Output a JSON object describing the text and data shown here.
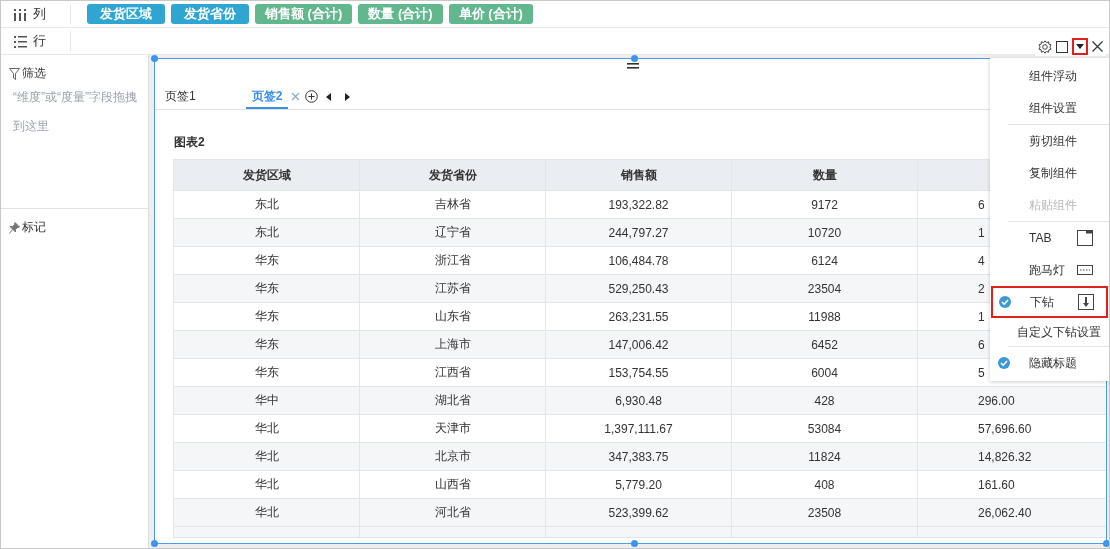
{
  "shelves": [
    {
      "label": "列",
      "kind": "columns",
      "fields": [
        {
          "label": "发货区域",
          "kind": "dimension"
        },
        {
          "label": "发货省份",
          "kind": "dimension"
        },
        {
          "label": "销售额 (合计)",
          "kind": "measure"
        },
        {
          "label": "数量 (合计)",
          "kind": "measure"
        },
        {
          "label": "单价 (合计)",
          "kind": "measure"
        }
      ]
    },
    {
      "label": "行",
      "kind": "rows"
    }
  ],
  "sidebar": {
    "filter": {
      "title": "筛选",
      "hint": "“维度”或“度量”字段拖拽到这里"
    },
    "marks": {
      "title": "标记"
    }
  },
  "tabs": [
    {
      "label": "页签1",
      "selected": false
    },
    {
      "label": "页签2",
      "selected": true
    }
  ],
  "component": {
    "title": "图表2",
    "table": {
      "columns": [
        "发货区域",
        "发货省份",
        "销售额",
        "数量"
      ],
      "rows": [
        [
          "东北",
          "吉林省",
          "193,322.82",
          "9172",
          "6"
        ],
        [
          "东北",
          "辽宁省",
          "244,797.27",
          "10720",
          "1"
        ],
        [
          "华东",
          "浙江省",
          "106,484.78",
          "6124",
          "4"
        ],
        [
          "华东",
          "江苏省",
          "529,250.43",
          "23504",
          "2"
        ],
        [
          "华东",
          "山东省",
          "263,231.55",
          "11988",
          "1"
        ],
        [
          "华东",
          "上海市",
          "147,006.42",
          "6452",
          "6"
        ],
        [
          "华东",
          "江西省",
          "153,754.55",
          "6004",
          "5"
        ],
        [
          "华中",
          "湖北省",
          "6,930.48",
          "428",
          "296.00"
        ],
        [
          "华北",
          "天津市",
          "1,397,111.67",
          "53084",
          "57,696.60"
        ],
        [
          "华北",
          "北京市",
          "347,383.75",
          "11824",
          "14,826.32"
        ],
        [
          "华北",
          "山西省",
          "5,779.20",
          "408",
          "161.60"
        ],
        [
          "华北",
          "河北省",
          "523,399.62",
          "23508",
          "26,062.40"
        ]
      ]
    }
  },
  "toolbar": {
    "dropdown_highlighted": true
  },
  "menu": [
    {
      "kind": "item",
      "label": "组件浮动",
      "checked": false,
      "disabled": false,
      "highlighted": false
    },
    {
      "kind": "item",
      "label": "组件设置",
      "checked": false,
      "disabled": false,
      "highlighted": false
    },
    {
      "kind": "divider"
    },
    {
      "kind": "item",
      "label": "剪切组件",
      "checked": false,
      "disabled": false,
      "highlighted": false
    },
    {
      "kind": "item",
      "label": "复制组件",
      "checked": false,
      "disabled": false,
      "highlighted": false
    },
    {
      "kind": "item",
      "label": "粘贴组件",
      "checked": false,
      "disabled": true,
      "highlighted": false
    },
    {
      "kind": "divider"
    },
    {
      "kind": "tab",
      "label": "TAB",
      "checked": false,
      "disabled": false,
      "highlighted": false
    },
    {
      "kind": "marquee",
      "label": "跑马灯",
      "checked": false,
      "disabled": false,
      "highlighted": false
    },
    {
      "kind": "drill",
      "label": "下钻",
      "checked": true,
      "disabled": false,
      "highlighted": true
    },
    {
      "kind": "sub",
      "label": "自定义下钻设置"
    },
    {
      "kind": "divider"
    },
    {
      "kind": "item",
      "label": "隐藏标题",
      "checked": true,
      "disabled": false,
      "highlighted": false
    }
  ]
}
